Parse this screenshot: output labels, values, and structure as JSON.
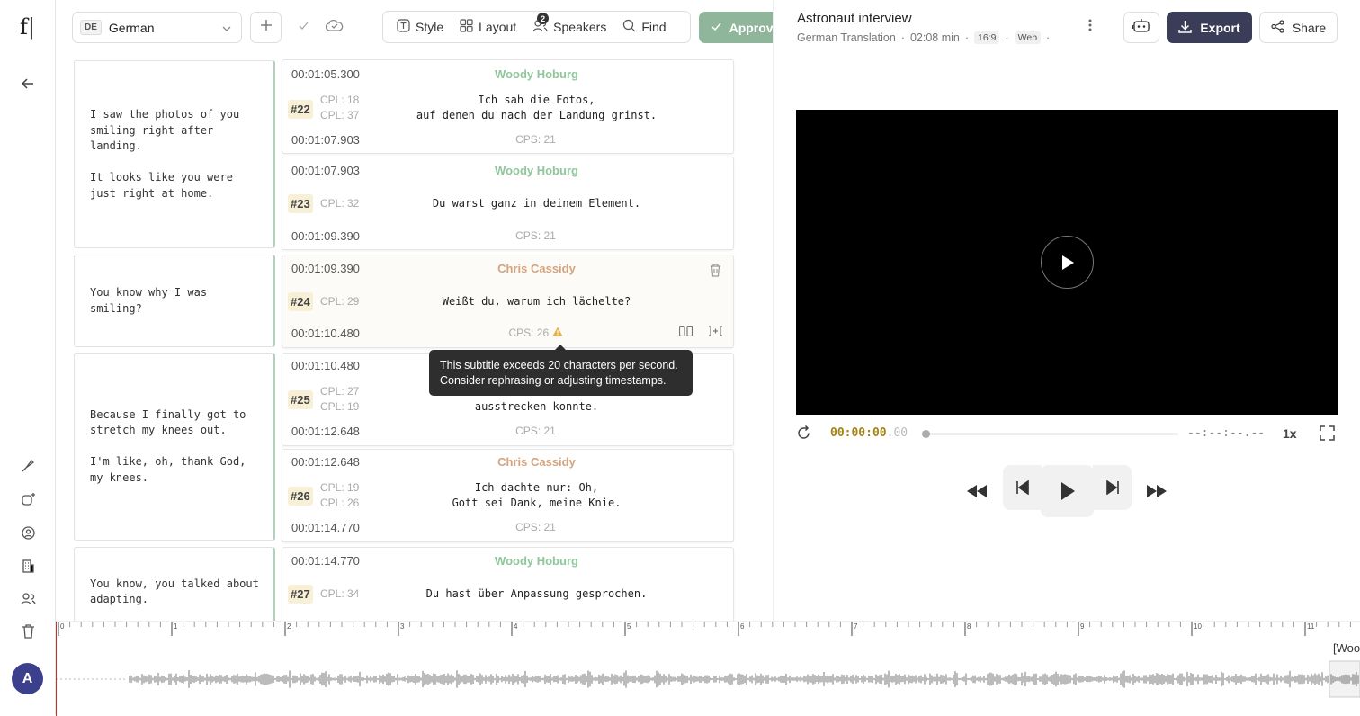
{
  "toolbar": {
    "language_code": "DE",
    "language_name": "German",
    "style_label": "Style",
    "layout_label": "Layout",
    "speakers_label": "Speakers",
    "speakers_count": "2",
    "find_label": "Find",
    "approve_label": "Approve"
  },
  "subtitles": [
    {
      "num": "#22",
      "start": "00:01:05.300",
      "end": "00:01:07.903",
      "speaker": "Woody Hoburg",
      "cpl1": "CPL: 18",
      "cpl2": "CPL: 37",
      "text": "Ich sah die Fotos,\nauf denen du nach der Landung grinst.",
      "cps": "CPS: 21"
    },
    {
      "num": "#23",
      "start": "00:01:07.903",
      "end": "00:01:09.390",
      "speaker": "Woody Hoburg",
      "cpl1": "CPL: 32",
      "cpl2": "",
      "text": "Du warst ganz in deinem Element.",
      "cps": "CPS: 21"
    },
    {
      "num": "#24",
      "start": "00:01:09.390",
      "end": "00:01:10.480",
      "speaker": "Chris Cassidy",
      "cpl1": "CPL: 29",
      "cpl2": "",
      "text": "Weißt du, warum ich lächelte?",
      "cps": "CPS: 26"
    },
    {
      "num": "#25",
      "start": "00:01:10.480",
      "end": "00:01:12.648",
      "speaker": "",
      "cpl1": "CPL: 27",
      "cpl2": "CPL: 19",
      "text": "ausstrecken konnte.",
      "cps": "CPS: 21"
    },
    {
      "num": "#26",
      "start": "00:01:12.648",
      "end": "00:01:14.770",
      "speaker": "Chris Cassidy",
      "cpl1": "CPL: 19",
      "cpl2": "CPL: 26",
      "text": "Ich dachte nur: Oh,\nGott sei Dank, meine Knie.",
      "cps": "CPS: 21"
    },
    {
      "num": "#27",
      "start": "00:01:14.770",
      "end": "",
      "speaker": "Woody Hoburg",
      "cpl1": "CPL: 34",
      "cpl2": "",
      "text": "Du hast über Anpassung gesprochen.",
      "cps": ""
    }
  ],
  "sources": [
    "I saw the photos of you\nsmiling right after\nlanding.\n\nIt looks like you were\njust right at home.",
    "You know why I was\nsmiling?",
    "Because I finally got to\nstretch my knees out.\n\nI'm like, oh, thank God,\nmy knees.",
    "You know, you talked about\nadapting."
  ],
  "tooltip": {
    "line1": "This subtitle exceeds 20 characters per second.",
    "line2": "Consider rephrasing or adjusting timestamps."
  },
  "project": {
    "title": "Astronaut interview",
    "subtitle": "German Translation",
    "duration": "02:08 min",
    "aspect": "16:9",
    "platform": "Web"
  },
  "actions": {
    "export_label": "Export",
    "share_label": "Share"
  },
  "player": {
    "time_main": "00:00:00",
    "time_ms": ".00",
    "end_time": "--:--:--.--",
    "rate": "1x"
  },
  "timeline": {
    "ticks": [
      "0",
      "1",
      "2",
      "3",
      "4",
      "5",
      "6",
      "7",
      "8",
      "9",
      "10",
      "11"
    ],
    "speaker_tag": "[Woo"
  },
  "user": {
    "initial": "A"
  },
  "colors": {
    "accent_green": "#8fb59b",
    "speaker_green": "#8fc79a",
    "speaker_orange": "#d5a47e",
    "export_bg": "#3a3d57",
    "avatar_bg": "#3c3f8c",
    "time_gold": "#a58416",
    "warning": "#e8b04a"
  },
  "icons": [
    "logo",
    "back-arrow-icon",
    "brush-icon",
    "video-plus-icon",
    "gear-people-icon",
    "building-icon",
    "users-icon",
    "trash-icon",
    "plus-icon",
    "check-icon",
    "cloud-icon",
    "style-icon",
    "layout-icon",
    "speakers-icon",
    "search-icon",
    "robot-icon",
    "download-icon",
    "share-icon",
    "kebab-icon",
    "play-icon",
    "replay-icon",
    "fullscreen-icon",
    "rewind-icon",
    "prev-icon",
    "next-icon",
    "forward-icon",
    "warning-icon",
    "split-icon",
    "merge-icon"
  ]
}
